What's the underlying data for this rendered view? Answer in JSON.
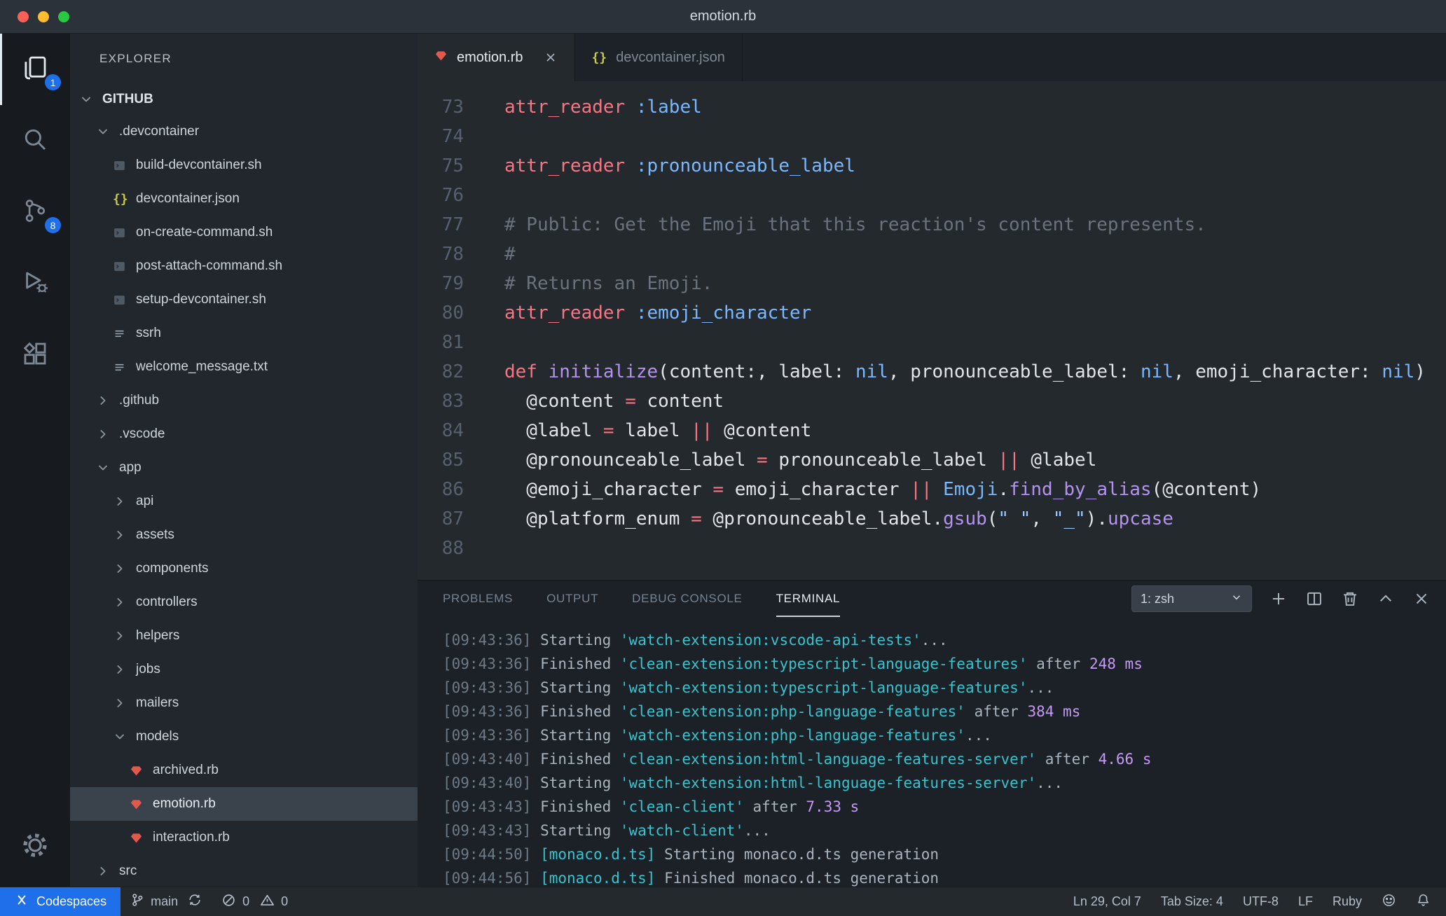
{
  "colors": {
    "codespaces_blue": "#1f6feb",
    "badge_blue": "#1f6feb",
    "ruby_red": "#e0584e",
    "json_yellow": "#cbcb41",
    "keyword_pink": "#f97583",
    "symbol_blue": "#79b8ff",
    "function_purple": "#b392f0",
    "comment_gray": "#6a737d",
    "terminal_cyan": "#3ac2cd",
    "terminal_purple": "#c49af5"
  },
  "title_bar": {
    "title": "emotion.rb"
  },
  "activity_bar": {
    "explorer_badge": "1",
    "source_control_badge": "8"
  },
  "sidebar": {
    "header": "EXPLORER",
    "tree": [
      {
        "label": "GITHUB",
        "level": 0,
        "kind": "root",
        "expanded": true
      },
      {
        "label": ".devcontainer",
        "level": 1,
        "kind": "folder",
        "expanded": true
      },
      {
        "label": "build-devcontainer.sh",
        "level": 2,
        "kind": "file",
        "icon": "shell"
      },
      {
        "label": "devcontainer.json",
        "level": 2,
        "kind": "file",
        "icon": "json"
      },
      {
        "label": "on-create-command.sh",
        "level": 2,
        "kind": "file",
        "icon": "shell"
      },
      {
        "label": "post-attach-command.sh",
        "level": 2,
        "kind": "file",
        "icon": "shell"
      },
      {
        "label": "setup-devcontainer.sh",
        "level": 2,
        "kind": "file",
        "icon": "shell"
      },
      {
        "label": "ssrh",
        "level": 2,
        "kind": "file",
        "icon": "list"
      },
      {
        "label": "welcome_message.txt",
        "level": 2,
        "kind": "file",
        "icon": "list"
      },
      {
        "label": ".github",
        "level": 1,
        "kind": "folder",
        "expanded": false
      },
      {
        "label": ".vscode",
        "level": 1,
        "kind": "folder",
        "expanded": false
      },
      {
        "label": "app",
        "level": 1,
        "kind": "folder",
        "expanded": true
      },
      {
        "label": "api",
        "level": 2,
        "kind": "folder",
        "expanded": false
      },
      {
        "label": "assets",
        "level": 2,
        "kind": "folder",
        "expanded": false
      },
      {
        "label": "components",
        "level": 2,
        "kind": "folder",
        "expanded": false
      },
      {
        "label": "controllers",
        "level": 2,
        "kind": "folder",
        "expanded": false
      },
      {
        "label": "helpers",
        "level": 2,
        "kind": "folder",
        "expanded": false
      },
      {
        "label": "jobs",
        "level": 2,
        "kind": "folder",
        "expanded": false
      },
      {
        "label": "mailers",
        "level": 2,
        "kind": "folder",
        "expanded": false
      },
      {
        "label": "models",
        "level": 2,
        "kind": "folder",
        "expanded": true
      },
      {
        "label": "archived.rb",
        "level": 3,
        "kind": "file",
        "icon": "ruby"
      },
      {
        "label": "emotion.rb",
        "level": 3,
        "kind": "file",
        "icon": "ruby",
        "selected": true
      },
      {
        "label": "interaction.rb",
        "level": 3,
        "kind": "file",
        "icon": "ruby"
      },
      {
        "label": "src",
        "level": 1,
        "kind": "folder",
        "expanded": false
      }
    ]
  },
  "editor": {
    "tabs": [
      {
        "label": "emotion.rb",
        "icon": "ruby",
        "active": true
      },
      {
        "label": "devcontainer.json",
        "icon": "json",
        "active": false
      }
    ],
    "code": [
      {
        "n": "73",
        "toks": [
          [
            "k",
            "attr_reader"
          ],
          [
            "p",
            " "
          ],
          [
            "s",
            ":label"
          ]
        ]
      },
      {
        "n": "74",
        "toks": []
      },
      {
        "n": "75",
        "toks": [
          [
            "k",
            "attr_reader"
          ],
          [
            "p",
            " "
          ],
          [
            "s",
            ":pronounceable_label"
          ]
        ]
      },
      {
        "n": "76",
        "toks": []
      },
      {
        "n": "77",
        "toks": [
          [
            "c",
            "# Public: Get the Emoji that this reaction's content represents."
          ]
        ]
      },
      {
        "n": "78",
        "toks": [
          [
            "c",
            "#"
          ]
        ]
      },
      {
        "n": "79",
        "toks": [
          [
            "c",
            "# Returns an Emoji."
          ]
        ]
      },
      {
        "n": "80",
        "toks": [
          [
            "k",
            "attr_reader"
          ],
          [
            "p",
            " "
          ],
          [
            "s",
            ":emoji_character"
          ]
        ]
      },
      {
        "n": "81",
        "toks": []
      },
      {
        "n": "82",
        "toks": [
          [
            "k",
            "def"
          ],
          [
            "p",
            " "
          ],
          [
            "f",
            "initialize"
          ],
          [
            "p",
            "(content:, label: "
          ],
          [
            "s",
            "nil"
          ],
          [
            "p",
            ", pronounceable_label: "
          ],
          [
            "s",
            "nil"
          ],
          [
            "p",
            ", emoji_character: "
          ],
          [
            "s",
            "nil"
          ],
          [
            "p",
            ")"
          ]
        ]
      },
      {
        "n": "83",
        "toks": [
          [
            "p",
            "  @content "
          ],
          [
            "k",
            "="
          ],
          [
            "p",
            " content"
          ]
        ]
      },
      {
        "n": "84",
        "toks": [
          [
            "p",
            "  @label "
          ],
          [
            "k",
            "="
          ],
          [
            "p",
            " label "
          ],
          [
            "k",
            "||"
          ],
          [
            "p",
            " @content"
          ]
        ]
      },
      {
        "n": "85",
        "toks": [
          [
            "p",
            "  @pronounceable_label "
          ],
          [
            "k",
            "="
          ],
          [
            "p",
            " pronounceable_label "
          ],
          [
            "k",
            "||"
          ],
          [
            "p",
            " @label"
          ]
        ]
      },
      {
        "n": "86",
        "toks": [
          [
            "p",
            "  @emoji_character "
          ],
          [
            "k",
            "="
          ],
          [
            "p",
            " emoji_character "
          ],
          [
            "k",
            "||"
          ],
          [
            "p",
            " "
          ],
          [
            "s",
            "Emoji"
          ],
          [
            "p",
            "."
          ],
          [
            "f",
            "find_by_alias"
          ],
          [
            "p",
            "(@content)"
          ]
        ]
      },
      {
        "n": "87",
        "toks": [
          [
            "p",
            "  @platform_enum "
          ],
          [
            "k",
            "="
          ],
          [
            "p",
            " @pronounceable_label."
          ],
          [
            "f",
            "gsub"
          ],
          [
            "p",
            "("
          ],
          [
            "x",
            "\" \""
          ],
          [
            "p",
            ", "
          ],
          [
            "x",
            "\"_\""
          ],
          [
            "p",
            ")."
          ],
          [
            "f",
            "upcase"
          ]
        ]
      },
      {
        "n": "88",
        "toks": []
      }
    ]
  },
  "panel": {
    "tabs": [
      {
        "label": "PROBLEMS"
      },
      {
        "label": "OUTPUT"
      },
      {
        "label": "DEBUG CONSOLE"
      },
      {
        "label": "TERMINAL",
        "active": true
      }
    ],
    "shell_select": "1: zsh",
    "terminal": [
      [
        [
          "ts",
          "[09:43:36]"
        ],
        [
          "p",
          " Starting "
        ],
        [
          "t",
          "'watch-extension:vscode-api-tests'"
        ],
        [
          "p",
          "..."
        ]
      ],
      [
        [
          "ts",
          "[09:43:36]"
        ],
        [
          "p",
          " Finished "
        ],
        [
          "t",
          "'clean-extension:typescript-language-features'"
        ],
        [
          "p",
          " after "
        ],
        [
          "d",
          "248 ms"
        ]
      ],
      [
        [
          "ts",
          "[09:43:36]"
        ],
        [
          "p",
          " Starting "
        ],
        [
          "t",
          "'watch-extension:typescript-language-features'"
        ],
        [
          "p",
          "..."
        ]
      ],
      [
        [
          "ts",
          "[09:43:36]"
        ],
        [
          "p",
          " Finished "
        ],
        [
          "t",
          "'clean-extension:php-language-features'"
        ],
        [
          "p",
          " after "
        ],
        [
          "d",
          "384 ms"
        ]
      ],
      [
        [
          "ts",
          "[09:43:36]"
        ],
        [
          "p",
          " Starting "
        ],
        [
          "t",
          "'watch-extension:php-language-features'"
        ],
        [
          "p",
          "..."
        ]
      ],
      [
        [
          "ts",
          "[09:43:40]"
        ],
        [
          "p",
          " Finished "
        ],
        [
          "t",
          "'clean-extension:html-language-features-server'"
        ],
        [
          "p",
          " after "
        ],
        [
          "d",
          "4.66 s"
        ]
      ],
      [
        [
          "ts",
          "[09:43:40]"
        ],
        [
          "p",
          " Starting "
        ],
        [
          "t",
          "'watch-extension:html-language-features-server'"
        ],
        [
          "p",
          "..."
        ]
      ],
      [
        [
          "ts",
          "[09:43:43]"
        ],
        [
          "p",
          " Finished "
        ],
        [
          "t",
          "'clean-client'"
        ],
        [
          "p",
          " after "
        ],
        [
          "d",
          "7.33 s"
        ]
      ],
      [
        [
          "ts",
          "[09:43:43]"
        ],
        [
          "p",
          " Starting "
        ],
        [
          "t",
          "'watch-client'"
        ],
        [
          "p",
          "..."
        ]
      ],
      [
        [
          "ts",
          "[09:44:50]"
        ],
        [
          "p",
          " "
        ],
        [
          "t",
          "[monaco.d.ts]"
        ],
        [
          "p",
          " Starting monaco.d.ts generation"
        ]
      ],
      [
        [
          "ts",
          "[09:44:56]"
        ],
        [
          "p",
          " "
        ],
        [
          "t",
          "[monaco.d.ts]"
        ],
        [
          "p",
          " Finished monaco.d.ts generation"
        ]
      ]
    ]
  },
  "status_bar": {
    "codespaces": "Codespaces",
    "branch": "main",
    "errors": "0",
    "warnings": "0",
    "cursor": "Ln 29, Col 7",
    "tab_size": "Tab Size: 4",
    "encoding": "UTF-8",
    "eol": "LF",
    "language": "Ruby"
  }
}
